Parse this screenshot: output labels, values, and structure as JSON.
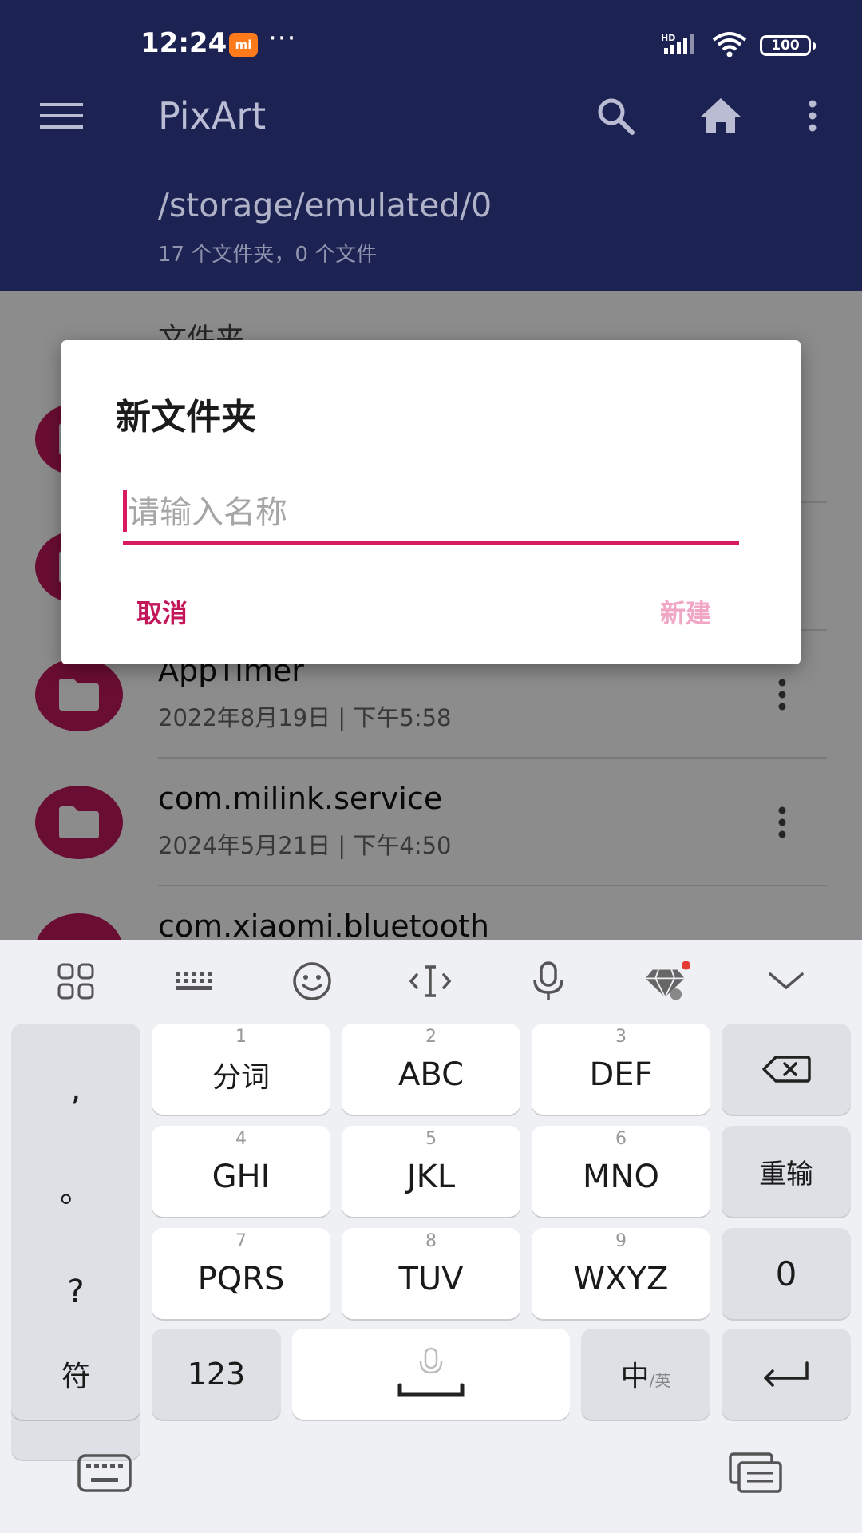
{
  "status_bar": {
    "time": "12:24",
    "mi_badge": "mi",
    "dots": "···",
    "network": "HD",
    "battery": "100"
  },
  "toolbar": {
    "title": "PixArt",
    "icons": [
      "menu-icon",
      "search-icon",
      "home-icon",
      "more-vert-icon"
    ]
  },
  "path": {
    "title": "/storage/emulated/0",
    "subtitle": "17 个文件夹，0 个文件"
  },
  "list": {
    "section_title": "文件夹",
    "items": [
      {
        "name": "",
        "date": ""
      },
      {
        "name": "",
        "date": ""
      },
      {
        "name": "AppTimer",
        "date": "2022年8月19日 | 下午5:58"
      },
      {
        "name": "com.milink.service",
        "date": "2024年5月21日 | 下午4:50"
      },
      {
        "name": "com.xiaomi.bluetooth",
        "date": ""
      }
    ]
  },
  "dialog": {
    "title": "新文件夹",
    "input_placeholder": "请输入名称",
    "input_value": "",
    "cancel_label": "取消",
    "create_label": "新建"
  },
  "keyboard": {
    "toolbar_icons": [
      "apps-grid-icon",
      "keyboard-layout-icon",
      "emoji-icon",
      "cursor-icon",
      "microphone-icon",
      "theme-diamond-icon",
      "collapse-icon"
    ],
    "punct": [
      ",",
      "。",
      "?",
      "!"
    ],
    "keys": [
      {
        "num": "1",
        "label": "分词"
      },
      {
        "num": "2",
        "label": "ABC"
      },
      {
        "num": "3",
        "label": "DEF"
      },
      {
        "num": "4",
        "label": "GHI"
      },
      {
        "num": "5",
        "label": "JKL"
      },
      {
        "num": "6",
        "label": "MNO"
      },
      {
        "num": "7",
        "label": "PQRS"
      },
      {
        "num": "8",
        "label": "TUV"
      },
      {
        "num": "9",
        "label": "WXYZ"
      }
    ],
    "reinput_label": "重输",
    "zero_label": "0",
    "symbol_label": "符",
    "numbers_label": "123",
    "lang_main": "中",
    "lang_sub": "/英"
  },
  "colors": {
    "header": "#1c2252",
    "accent": "#c2185b",
    "keyboard_bg": "#eef0f3"
  }
}
